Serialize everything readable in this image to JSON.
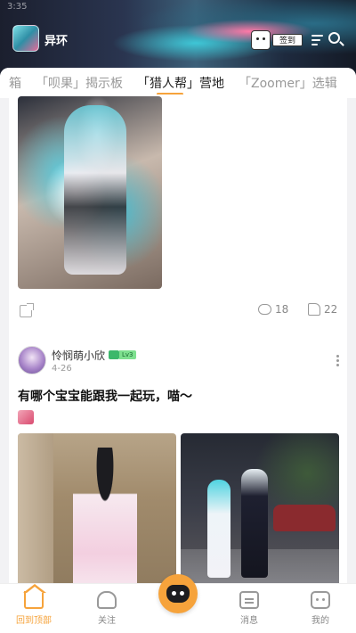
{
  "status": {
    "time": "3:35"
  },
  "header": {
    "app_name": "异环",
    "signin_label": "签到"
  },
  "tabs": [
    {
      "label": "箱"
    },
    {
      "label": "「呗果」揭示板"
    },
    {
      "label": "「猎人帮」营地",
      "active": true
    },
    {
      "label": "「Zoomer」选辑"
    }
  ],
  "post1": {
    "comments": "18",
    "likes": "22"
  },
  "post2": {
    "username": "怜悯萌小欣",
    "level": "Lv3",
    "date": "4-26",
    "title": "有哪个宝宝能跟我一起玩，喵～"
  },
  "bottom_nav": {
    "home": "回到顶部",
    "follow": "关注",
    "messages": "消息",
    "mine": "我的"
  },
  "colors": {
    "accent": "#f6a33b",
    "level_green": "#7ee08f"
  }
}
